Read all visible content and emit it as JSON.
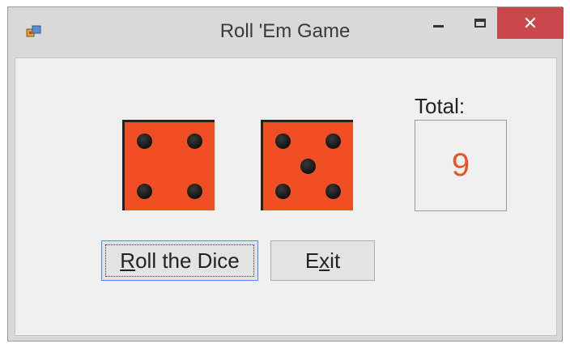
{
  "window": {
    "title": "Roll 'Em Game",
    "close_symbol": "✕"
  },
  "dice": [
    {
      "value": 4
    },
    {
      "value": 5
    }
  ],
  "total": {
    "label": "Total:",
    "value": "9"
  },
  "buttons": {
    "roll": {
      "prefix": "R",
      "rest": "oll the Dice"
    },
    "exit": {
      "prefix": "E",
      "mid": "x",
      "rest": "it"
    }
  },
  "colors": {
    "die_face": "#f04e23",
    "pip": "#111111",
    "total_text": "#e8532a",
    "close_button": "#c9474a"
  }
}
